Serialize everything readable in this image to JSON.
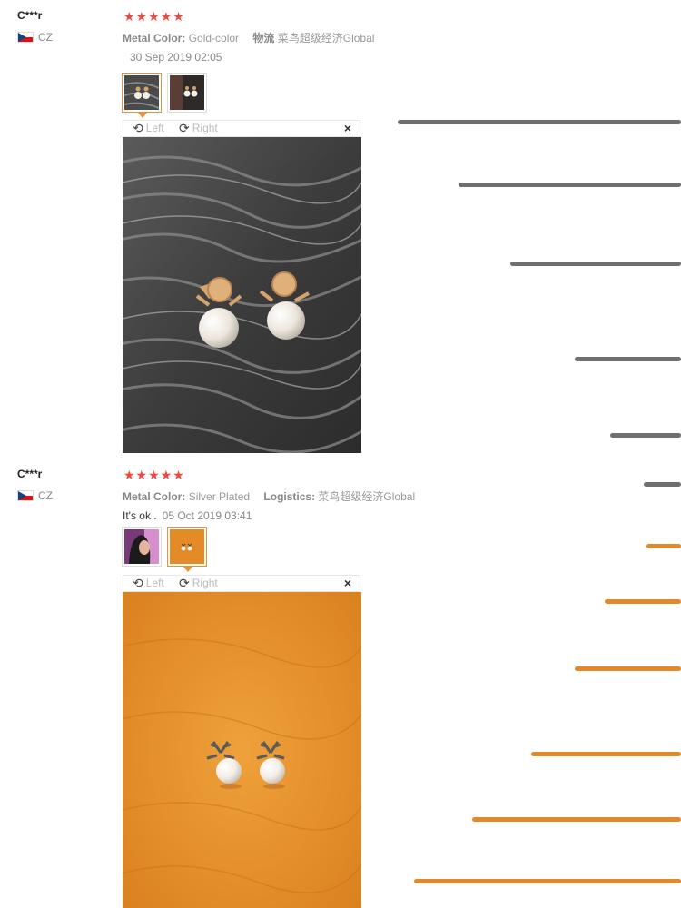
{
  "reviews": [
    {
      "user": "C***r",
      "country": "CZ",
      "stars": "★★★★★",
      "prop1_label": "Metal Color:",
      "prop1_value": "Gold-color",
      "prop2_label": "物流",
      "prop2_value": "菜鸟超级经济Global",
      "feedback_text": "",
      "date": "30 Sep 2019 02:05",
      "viewer": {
        "left_label": "Left",
        "right_label": "Right",
        "close": "×"
      }
    },
    {
      "user": "C***r",
      "country": "CZ",
      "stars": "★★★★★",
      "prop1_label": "Metal Color:",
      "prop1_value": "Silver Plated",
      "prop2_label": "Logistics:",
      "prop2_value": "菜鸟超级经济Global",
      "feedback_text": "It's ok .",
      "date": "05 Oct 2019 03:41",
      "viewer": {
        "left_label": "Left",
        "right_label": "Right",
        "close": "×"
      }
    }
  ],
  "icons": {
    "rotate_left": "rotate-left-icon",
    "rotate_right": "rotate-right-icon",
    "close": "close-icon",
    "flag": "czech-flag-icon"
  },
  "colors": {
    "stars": "#f0473e",
    "active_thumb": "#e8913a",
    "gray_lines": "#6f6f6f",
    "orange_lines": "#e08a2c"
  }
}
